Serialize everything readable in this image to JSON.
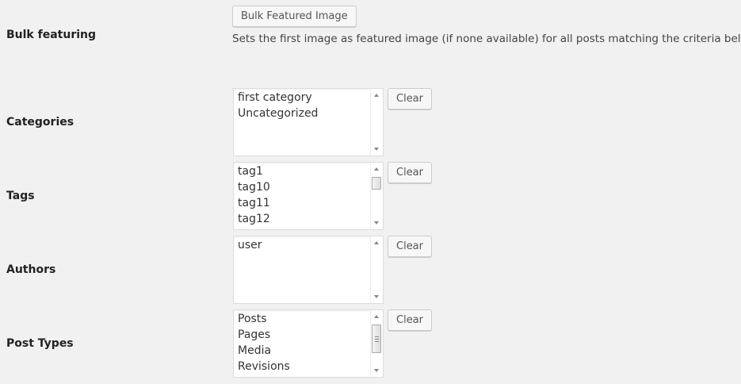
{
  "bulk": {
    "label": "Bulk featuring",
    "button": "Bulk Featured Image",
    "description": "Sets the first image as featured image (if none available) for all posts matching the criteria below."
  },
  "categories": {
    "label": "Categories",
    "clear": "Clear",
    "items": [
      "first category",
      "Uncategorized"
    ]
  },
  "tags": {
    "label": "Tags",
    "clear": "Clear",
    "items": [
      "tag1",
      "tag10",
      "tag11",
      "tag12"
    ]
  },
  "authors": {
    "label": "Authors",
    "clear": "Clear",
    "items": [
      "user"
    ]
  },
  "post_types": {
    "label": "Post Types",
    "clear": "Clear",
    "items": [
      "Posts",
      "Pages",
      "Media",
      "Revisions"
    ]
  }
}
